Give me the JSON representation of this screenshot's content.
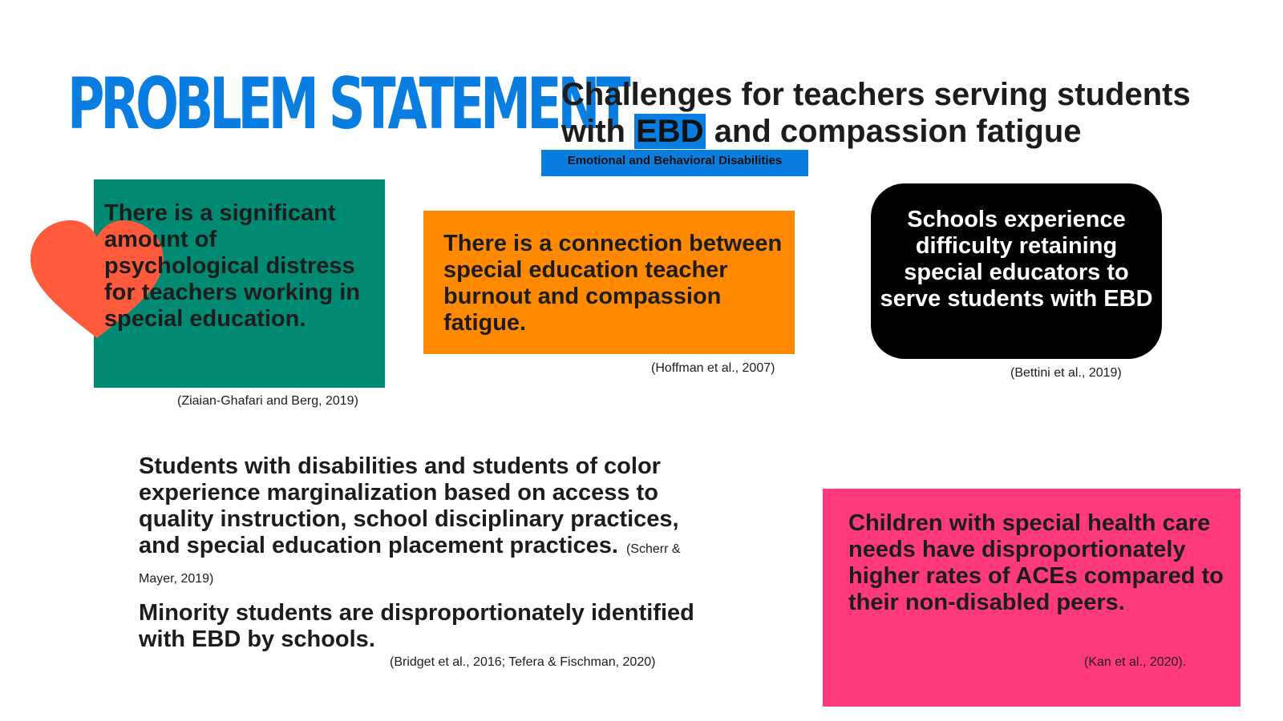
{
  "title": "PROBLEM STATEMENT",
  "subtitle": {
    "line1": "Challenges for teachers serving students",
    "with": "with",
    "ebd": "EBD",
    "rest": "and compassion fatigue"
  },
  "ebd_definition": "Emotional and Behavioral Disabilities",
  "cards": {
    "green": {
      "text": "There is a significant amount of psychological distress for teachers working in special education.",
      "citation": "(Ziaian-Ghafari and Berg, 2019)",
      "color": "#008a73"
    },
    "orange": {
      "text": "There is a connection between special education teacher burnout and compassion fatigue.",
      "citation": "(Hoffman et al., 2007)",
      "color": "#ff8a00"
    },
    "black": {
      "text": "Schools experience difficulty retaining special educators to serve students with EBD",
      "citation": "(Bettini et al., 2019)",
      "color": "#000000"
    },
    "pink": {
      "text": "Children with special health care needs have disproportionately higher rates of ACEs compared to their non-disabled peers.",
      "citation": "(Kan et al., 2020).",
      "color": "#ff3a7a"
    }
  },
  "paragraphs": {
    "marginalization": {
      "text": "Students with disabilities and students of color experience marginalization based on access to quality instruction, school disciplinary practices, and special education placement practices.",
      "citation": "(Scherr & Mayer, 2019)"
    },
    "minority": {
      "text": "Minority students are disproportionately identified with EBD by schools.",
      "citation": "(Bridget et al., 2016; Tefera & Fischman, 2020)"
    }
  },
  "icons": {
    "heart": "heart-icon"
  },
  "colors": {
    "accent_blue": "#0a7ee0",
    "heart": "#ff5a3c"
  }
}
